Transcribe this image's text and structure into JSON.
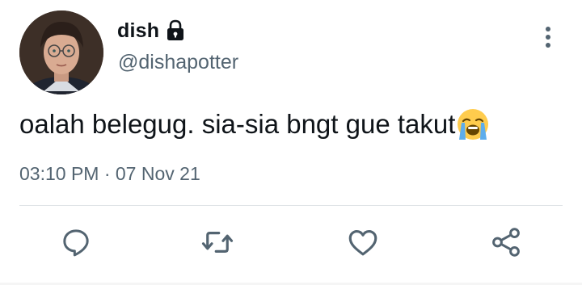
{
  "user": {
    "display_name": "dish",
    "handle": "@dishapotter",
    "protected_icon": "lock-icon",
    "avatar": "profile-avatar"
  },
  "tweet": {
    "text": "oalah belegug. sia-sia bngt gue takut",
    "emoji": "loudly-crying-face-emoji",
    "timestamp": "03:10 PM · 07 Nov 21"
  },
  "actions": {
    "reply_icon": "reply-icon",
    "retweet_icon": "retweet-icon",
    "like_icon": "heart-icon",
    "share_icon": "share-icon",
    "more_icon": "more-vertical-icon"
  },
  "colors": {
    "text": "#0f1419",
    "secondary": "#536471",
    "icon": "#536471",
    "divider": "#dfe3e6"
  }
}
